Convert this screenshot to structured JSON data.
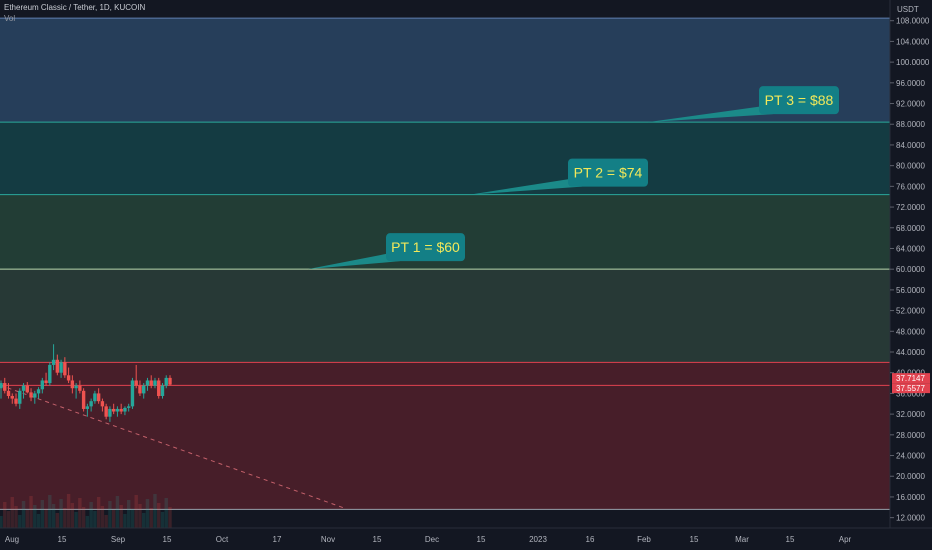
{
  "header": {
    "symbol": "Ethereum Classic / Tether, 1D, KUCOIN",
    "volume_label": "Vol",
    "currency": "USDT"
  },
  "chart_data": {
    "type": "candlestick",
    "ylim": [
      10,
      112
    ],
    "y_ticks": [
      "12.0000",
      "16.0000",
      "20.0000",
      "24.0000",
      "28.0000",
      "32.0000",
      "36.0000",
      "40.0000",
      "44.0000",
      "48.0000",
      "52.0000",
      "56.0000",
      "60.0000",
      "64.0000",
      "68.0000",
      "72.0000",
      "76.0000",
      "80.0000",
      "84.0000",
      "88.0000",
      "92.0000",
      "96.0000",
      "100.0000",
      "104.0000",
      "108.0000"
    ],
    "x_ticks": [
      "Aug",
      "15",
      "Sep",
      "15",
      "Oct",
      "17",
      "Nov",
      "15",
      "Dec",
      "15",
      "2023",
      "16",
      "Feb",
      "15",
      "Mar",
      "15",
      "Apr"
    ],
    "price_labels": [
      {
        "text": "37.7147",
        "value": 37.71
      },
      {
        "text": "37.5577",
        "value": 37.56
      }
    ],
    "zones": [
      {
        "from": 88.4,
        "to": 108.5,
        "color": "#27405e"
      },
      {
        "from": 74.4,
        "to": 88.4,
        "color": "#143d45"
      },
      {
        "from": 60.0,
        "to": 74.4,
        "color": "#233f37"
      },
      {
        "from": 42.0,
        "to": 60.0,
        "color": "#283b38"
      },
      {
        "from": 13.6,
        "to": 42.0,
        "color": "#4a1f2a"
      }
    ],
    "levels": [
      {
        "value": 108.5,
        "color": "#5f7fb0"
      },
      {
        "value": 88.4,
        "color": "#2aa99c"
      },
      {
        "value": 74.4,
        "color": "#2aa99c"
      },
      {
        "value": 60.0,
        "color": "#b8d8ad"
      },
      {
        "value": 42.0,
        "color": "#e0424f"
      },
      {
        "value": 37.56,
        "color": "#e0424f"
      },
      {
        "value": 13.6,
        "color": "#9aa0aa"
      }
    ],
    "targets": [
      {
        "label": "PT 1 = $60",
        "value": 60
      },
      {
        "label": "PT 2 = $74",
        "value": 74.4
      },
      {
        "label": "PT 3 = $88",
        "value": 88.4
      }
    ],
    "trendline": {
      "from": [
        0,
        37.6
      ],
      "to": [
        345,
        13.8
      ]
    },
    "candles": [
      {
        "o": 37,
        "h": 38.5,
        "l": 35,
        "c": 38
      },
      {
        "o": 38,
        "h": 39,
        "l": 36,
        "c": 36.5
      },
      {
        "o": 36.5,
        "h": 38,
        "l": 35,
        "c": 35.5
      },
      {
        "o": 35.5,
        "h": 36,
        "l": 34,
        "c": 35
      },
      {
        "o": 35,
        "h": 36,
        "l": 33.5,
        "c": 34
      },
      {
        "o": 34,
        "h": 37,
        "l": 33,
        "c": 36.5
      },
      {
        "o": 36.5,
        "h": 38,
        "l": 35,
        "c": 37.5
      },
      {
        "o": 37.5,
        "h": 38.2,
        "l": 36,
        "c": 36.2
      },
      {
        "o": 36.2,
        "h": 37,
        "l": 34.5,
        "c": 35.2
      },
      {
        "o": 35.2,
        "h": 36.5,
        "l": 34,
        "c": 36
      },
      {
        "o": 36,
        "h": 37.2,
        "l": 35,
        "c": 36.8
      },
      {
        "o": 36.8,
        "h": 39,
        "l": 36,
        "c": 38.5
      },
      {
        "o": 38.5,
        "h": 40,
        "l": 37.5,
        "c": 38
      },
      {
        "o": 38,
        "h": 42,
        "l": 37.5,
        "c": 41.5
      },
      {
        "o": 41.5,
        "h": 45.5,
        "l": 40.5,
        "c": 42.5
      },
      {
        "o": 42.5,
        "h": 43.5,
        "l": 39.5,
        "c": 40
      },
      {
        "o": 40,
        "h": 42.5,
        "l": 39,
        "c": 42
      },
      {
        "o": 42,
        "h": 43,
        "l": 39,
        "c": 39.5
      },
      {
        "o": 39.5,
        "h": 41,
        "l": 38,
        "c": 38.5
      },
      {
        "o": 38.5,
        "h": 39.5,
        "l": 36,
        "c": 37
      },
      {
        "o": 37,
        "h": 38,
        "l": 35,
        "c": 37.5
      },
      {
        "o": 37.5,
        "h": 38.5,
        "l": 36,
        "c": 36.5
      },
      {
        "o": 36.5,
        "h": 37,
        "l": 32.5,
        "c": 33
      },
      {
        "o": 33,
        "h": 34,
        "l": 31.5,
        "c": 33.5
      },
      {
        "o": 33.5,
        "h": 35,
        "l": 32.5,
        "c": 34.5
      },
      {
        "o": 34.5,
        "h": 36.5,
        "l": 34,
        "c": 36
      },
      {
        "o": 36,
        "h": 37,
        "l": 34,
        "c": 34.5
      },
      {
        "o": 34.5,
        "h": 35,
        "l": 32.5,
        "c": 33.5
      },
      {
        "o": 33.5,
        "h": 34,
        "l": 31,
        "c": 31.5
      },
      {
        "o": 31.5,
        "h": 33.5,
        "l": 30.5,
        "c": 33
      },
      {
        "o": 33,
        "h": 34,
        "l": 32,
        "c": 32.5
      },
      {
        "o": 32.5,
        "h": 33.5,
        "l": 31.5,
        "c": 33
      },
      {
        "o": 33,
        "h": 34,
        "l": 32,
        "c": 32.5
      },
      {
        "o": 32.5,
        "h": 33.5,
        "l": 31.8,
        "c": 33.2
      },
      {
        "o": 33.2,
        "h": 34,
        "l": 32.5,
        "c": 33.5
      },
      {
        "o": 33.5,
        "h": 39,
        "l": 33,
        "c": 38.5
      },
      {
        "o": 38.5,
        "h": 41.5,
        "l": 37,
        "c": 37.5
      },
      {
        "o": 37.5,
        "h": 38.5,
        "l": 35.5,
        "c": 36
      },
      {
        "o": 36,
        "h": 38,
        "l": 35,
        "c": 37.5
      },
      {
        "o": 37.5,
        "h": 39,
        "l": 36.5,
        "c": 38.5
      },
      {
        "o": 38.5,
        "h": 39.5,
        "l": 37,
        "c": 37.5
      },
      {
        "o": 37.5,
        "h": 39,
        "l": 37,
        "c": 38.5
      },
      {
        "o": 38.5,
        "h": 39,
        "l": 35,
        "c": 35.5
      },
      {
        "o": 35.5,
        "h": 38,
        "l": 35,
        "c": 37.5
      },
      {
        "o": 37.5,
        "h": 39.5,
        "l": 37,
        "c": 39
      },
      {
        "o": 39,
        "h": 39.5,
        "l": 37.5,
        "c": 37.71
      }
    ]
  }
}
